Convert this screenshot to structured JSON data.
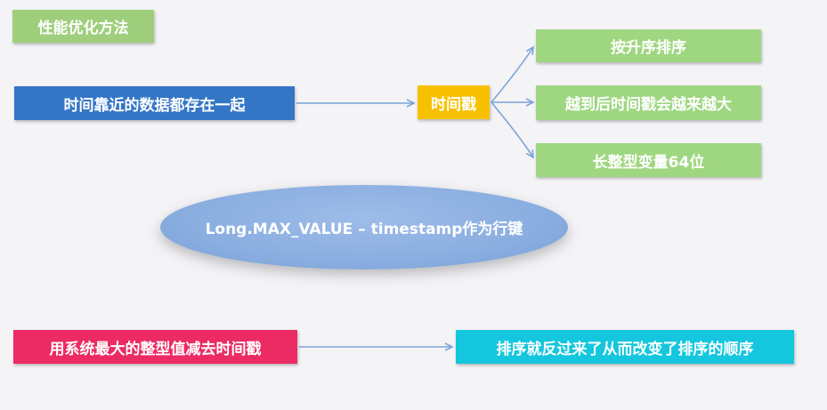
{
  "title": "性能优化方法",
  "nodes": {
    "source": "时间靠近的数据都存在一起",
    "timestamp": "时间戳",
    "sorted": "按升序排序",
    "later_larger": "越到后时间戳会越来越大",
    "long_var": "长整型变量64位",
    "rowkey": "Long.MAX_VALUE – timestamp作为行键",
    "subtract": "用系统最大的整型值减去时间戳",
    "reverse": "排序就反过来了从而改变了排序的顺序"
  },
  "colors": {
    "title": "#9fcf7c",
    "source": "#3476c6",
    "timestamp": "#f7c100",
    "branches": "#9fd781",
    "ellipse": "#8aaee0",
    "subtract": "#ec2a64",
    "reverse": "#14c7de",
    "arrow": "#7aa3d8"
  }
}
